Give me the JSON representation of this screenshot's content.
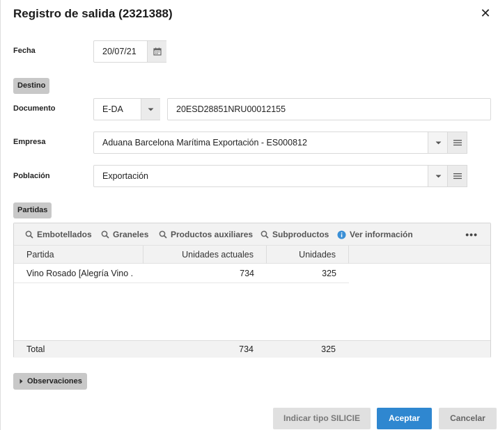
{
  "dialog": {
    "title": "Registro de salida (2321388)",
    "close_icon": "close-icon"
  },
  "fecha": {
    "label": "Fecha",
    "value": "20/07/21",
    "icon": "calendar-icon"
  },
  "destino_section": "Destino",
  "documento": {
    "label": "Documento",
    "type_value": "E-DA",
    "number_value": "20ESD28851NRU00012155"
  },
  "empresa": {
    "label": "Empresa",
    "value": "Aduana Barcelona Marítima Exportación - ES000812"
  },
  "poblacion": {
    "label": "Población",
    "value": "Exportación"
  },
  "partidas_section": "Partidas",
  "toolbar": {
    "items": [
      {
        "label": "Embotellados",
        "icon": "search-icon"
      },
      {
        "label": "Graneles",
        "icon": "search-icon"
      },
      {
        "label": "Productos auxiliares",
        "icon": "search-icon"
      },
      {
        "label": "Subproductos",
        "icon": "search-icon"
      },
      {
        "label": "Ver información",
        "icon": "info-icon"
      }
    ],
    "more": "•••"
  },
  "table": {
    "columns": [
      "Partida",
      "Unidades actuales",
      "Unidades"
    ],
    "rows": [
      {
        "partida": "Vino Rosado [Alegría Vino ...",
        "unidades_actuales": "734",
        "unidades": "325"
      }
    ],
    "footer": {
      "label": "Total",
      "unidades_actuales": "734",
      "unidades": "325"
    }
  },
  "observaciones": "Observaciones",
  "buttons": {
    "silicie": "Indicar tipo SILICIE",
    "aceptar": "Aceptar",
    "cancelar": "Cancelar"
  },
  "colors": {
    "primary": "#2f87d0",
    "info": "#3a8fd6",
    "secondary_btn": "#e0e0e0"
  }
}
